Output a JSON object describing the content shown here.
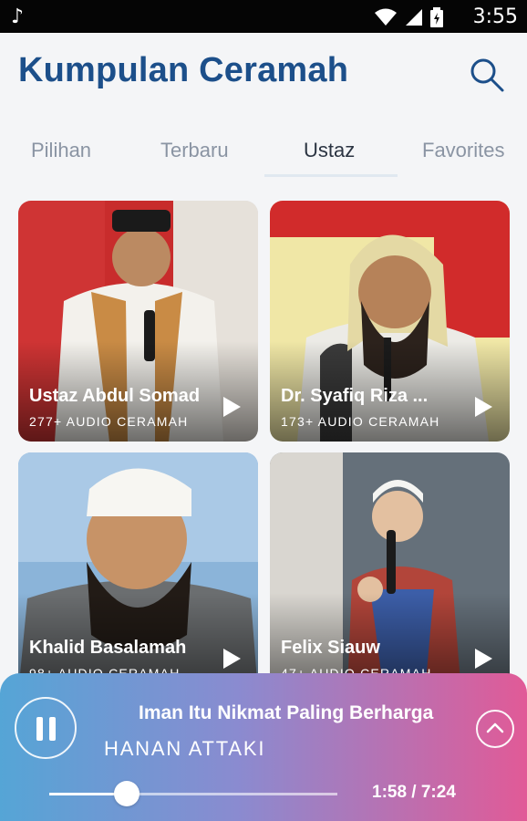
{
  "status_bar": {
    "time": "3:55",
    "icons": [
      "music-note-icon",
      "wifi-icon",
      "signal-icon",
      "battery-icon"
    ]
  },
  "app": {
    "title": "Kumpulan Ceramah",
    "search_icon": "search-icon"
  },
  "tabs": [
    {
      "label": "Pilihan",
      "active": false
    },
    {
      "label": "Terbaru",
      "active": false
    },
    {
      "label": "Ustaz",
      "active": true
    },
    {
      "label": "Favorites",
      "active": false
    }
  ],
  "ustaz": [
    {
      "name": "Ustaz Abdul Somad",
      "count": "277+ AUDIO CERAMAH"
    },
    {
      "name": "Dr. Syafiq Riza ...",
      "count": "173+ AUDIO CERAMAH"
    },
    {
      "name": "Khalid Basalamah",
      "count": "98+ AUDIO CERAMAH"
    },
    {
      "name": "Felix Siauw",
      "count": "47+ AUDIO CERAMAH"
    }
  ],
  "player": {
    "title": "Iman Itu Nikmat Paling Berharga",
    "artist": "HANAN ATTAKI",
    "elapsed": "1:58",
    "duration": "7:24",
    "timecode": "1:58 / 7:24",
    "progress": 0.27,
    "gradient": [
      "#55a5d6",
      "#8a8bd0",
      "#e15a97"
    ]
  },
  "colors": {
    "title": "#1c4f8a",
    "tab_inactive": "#8a94a3",
    "tab_active": "#2b3442",
    "status_bar": "#050505"
  }
}
